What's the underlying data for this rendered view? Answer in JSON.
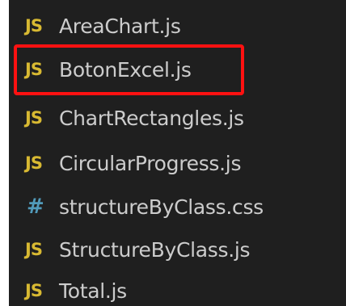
{
  "explorer": {
    "files": [
      {
        "icon": "JS",
        "icon_type": "js-icon",
        "name": "AreaChart.js"
      },
      {
        "icon": "JS",
        "icon_type": "js-icon",
        "name": "BotonExcel.js",
        "highlighted": true
      },
      {
        "icon": "JS",
        "icon_type": "js-icon",
        "name": "ChartRectangles.js"
      },
      {
        "icon": "JS",
        "icon_type": "js-icon",
        "name": "CircularProgress.js"
      },
      {
        "icon": "#",
        "icon_type": "css-icon",
        "name": "structureByClass.css"
      },
      {
        "icon": "JS",
        "icon_type": "js-icon",
        "name": "StructureByClass.js"
      },
      {
        "icon": "JS",
        "icon_type": "js-icon",
        "name": "Total.js"
      }
    ]
  },
  "colors": {
    "background": "#1f1f1f",
    "text": "#cccccc",
    "js_icon": "#d8b932",
    "css_icon": "#519aba",
    "highlight": "#ff1111"
  }
}
